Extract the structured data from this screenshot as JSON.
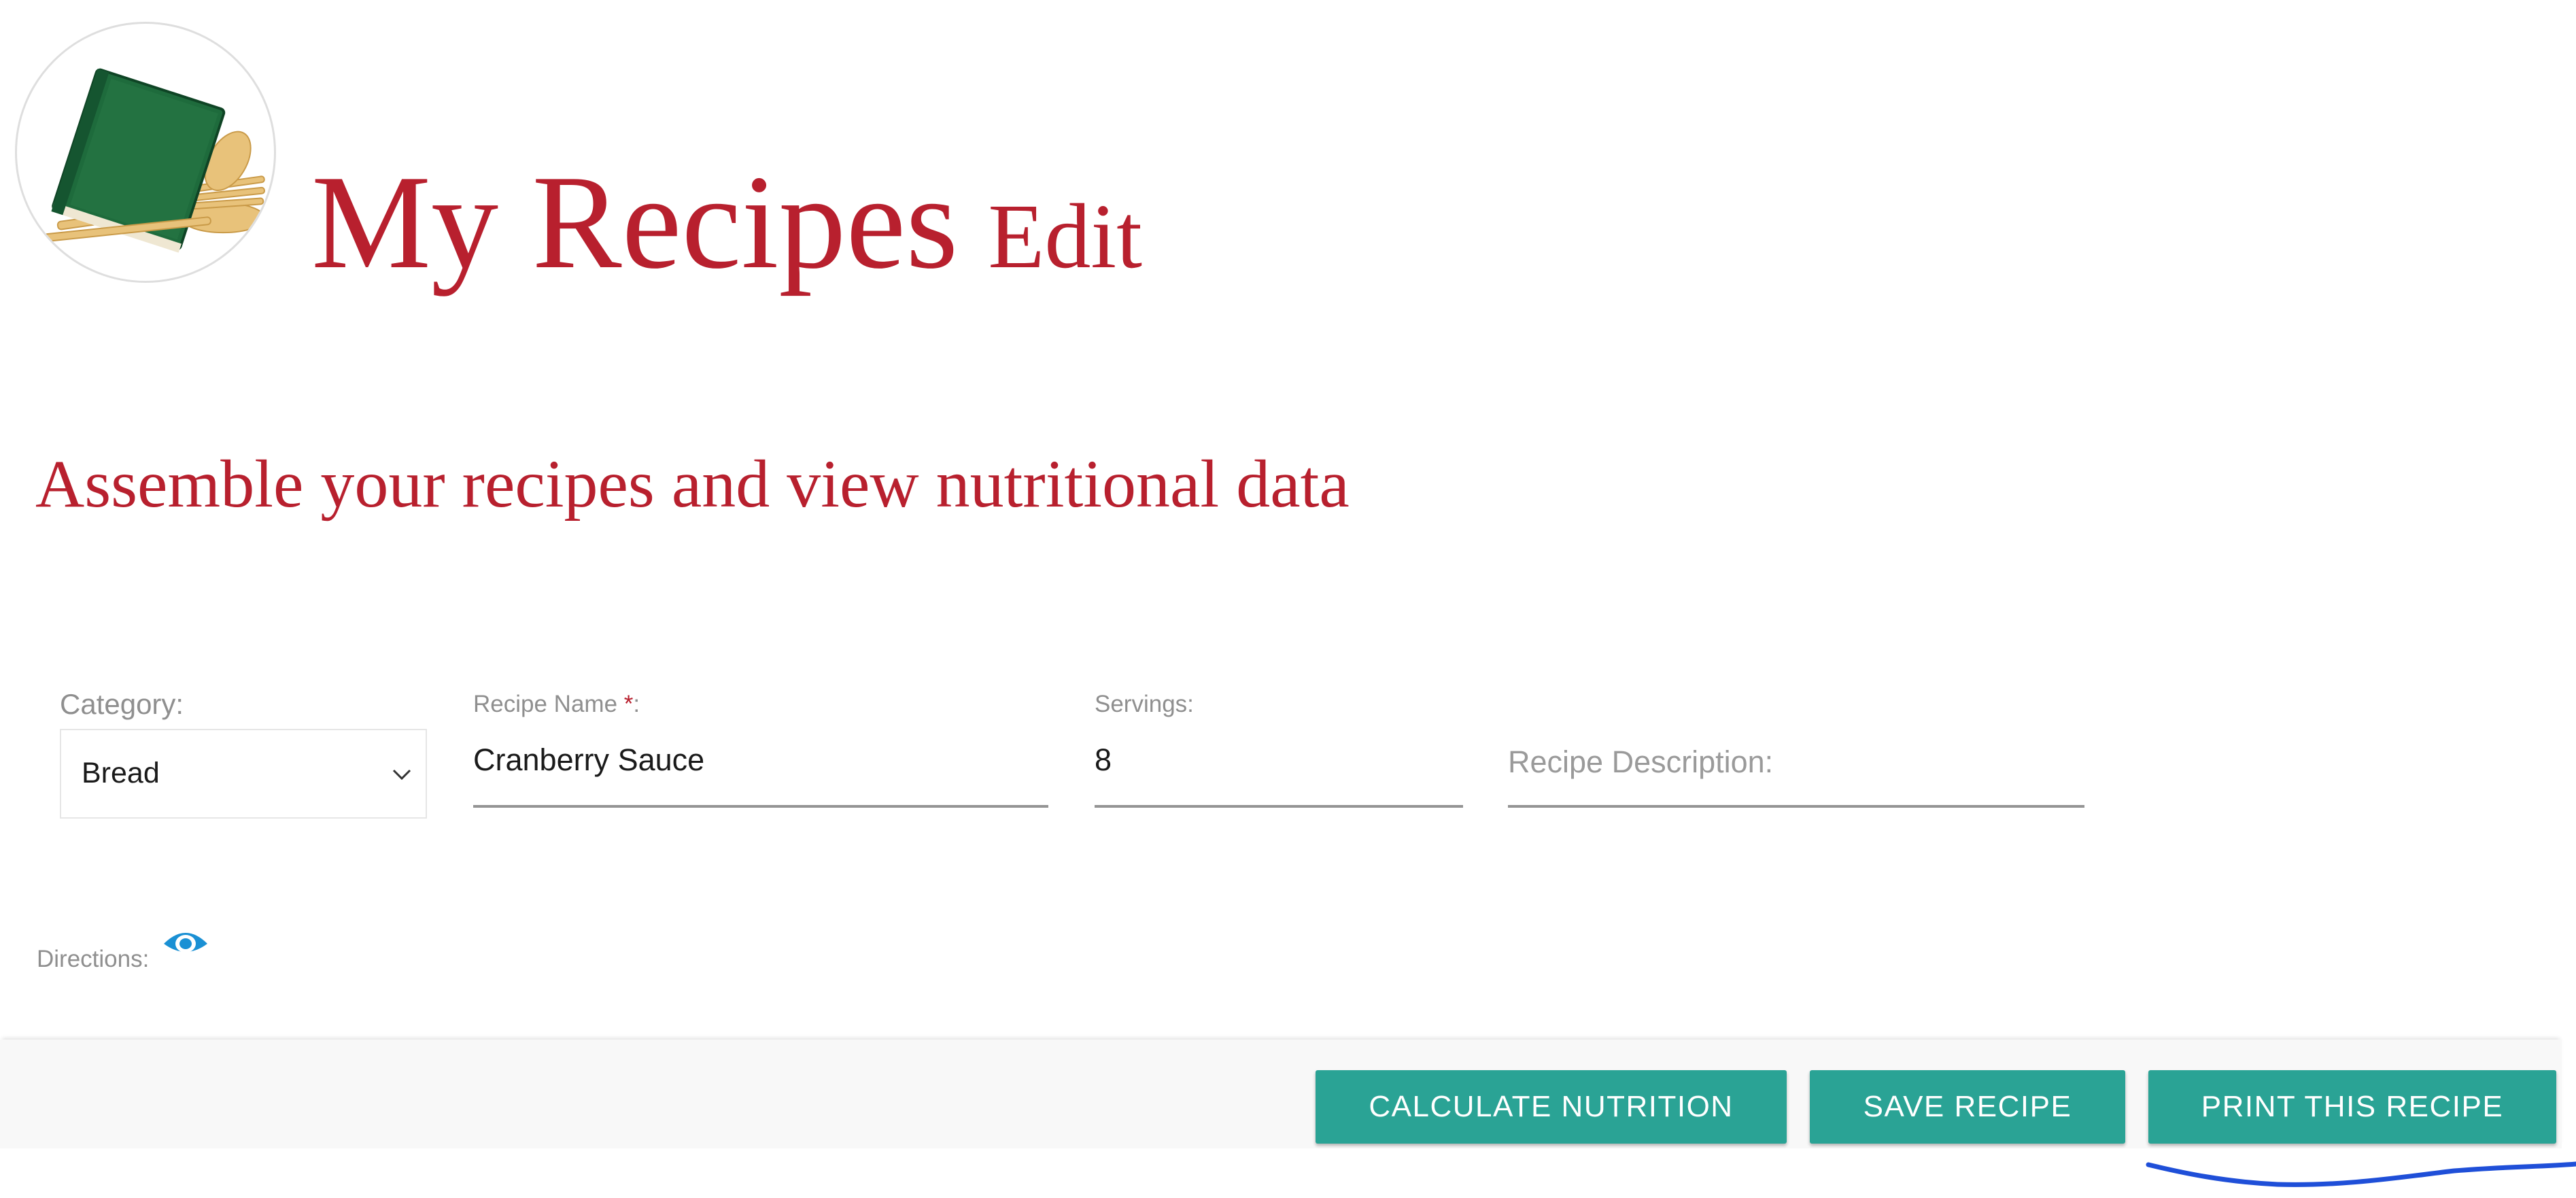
{
  "header": {
    "title": "My Recipes",
    "mode": "Edit",
    "tagline": "Assemble your recipes and view nutritional data",
    "logo_icon": "recipe-book-utensils-icon"
  },
  "form": {
    "category": {
      "label": "Category:",
      "value": "Bread",
      "icon": "chevron-down-icon"
    },
    "recipe_name": {
      "label": "Recipe Name ",
      "required_mark": "*",
      "label_suffix": ":",
      "value": "Cranberry Sauce"
    },
    "servings": {
      "label": "Servings:",
      "value": "8"
    },
    "description": {
      "placeholder": "Recipe Description:",
      "value": ""
    },
    "directions": {
      "label": "Directions:",
      "toggle_icon": "eye-icon"
    }
  },
  "footer": {
    "calculate_label": "CALCULATE NUTRITION",
    "save_label": "SAVE RECIPE",
    "print_label": "PRINT THIS RECIPE"
  },
  "colors": {
    "brand_red": "#b8202e",
    "teal": "#2aa395",
    "eye_blue": "#1a90d4",
    "annotation_blue": "#1f4fd8"
  }
}
